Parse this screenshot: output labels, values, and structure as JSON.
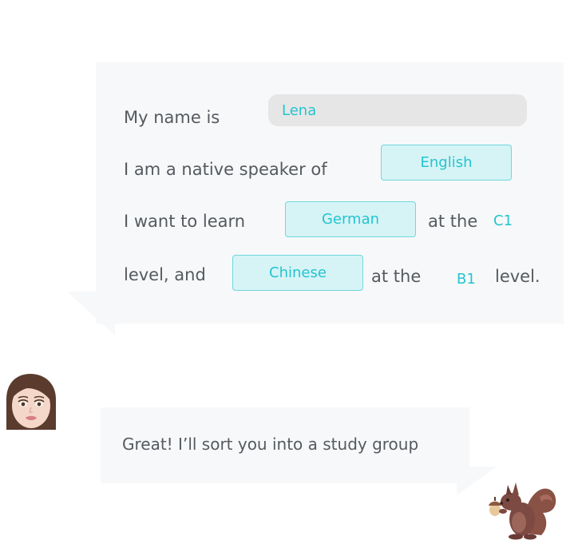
{
  "form": {
    "line1_prefix": "My name is",
    "name_value": "Lena",
    "line2_prefix": "I am a native speaker of",
    "native_language": "English",
    "line3_prefix": "I want to learn",
    "learn_language_1": "German",
    "line3_at_the": "at the",
    "level_1": "C1",
    "line4_prefix": "level,  and",
    "learn_language_2": "Chinese",
    "line4_at_the": "at the",
    "level_2": "B1",
    "line4_suffix": "level."
  },
  "reply": {
    "message": "Great! I’ll sort you into a study group"
  },
  "avatars": {
    "user": "girl-avatar-icon",
    "bot": "squirrel-avatar-icon"
  },
  "colors": {
    "accent": "#25c4cf",
    "field_bg": "#d6f4f6",
    "bubble_bg": "#f7f8f9",
    "text": "#555a5f"
  }
}
